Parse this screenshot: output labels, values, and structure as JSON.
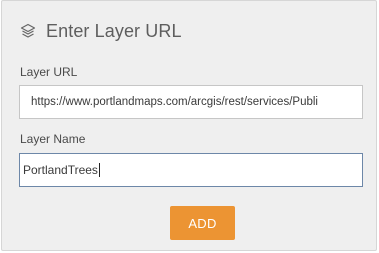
{
  "header": {
    "icon": "layers-icon",
    "title": "Enter Layer URL"
  },
  "form": {
    "url_label": "Layer URL",
    "url_value": "https://www.portlandmaps.com/arcgis/rest/services/Publi",
    "name_label": "Layer Name",
    "name_value": "PortlandTrees"
  },
  "actions": {
    "add_label": "ADD"
  },
  "colors": {
    "panel_bg": "#efefef",
    "button_bg": "#ec9433",
    "focused_border": "#6d87a8"
  }
}
